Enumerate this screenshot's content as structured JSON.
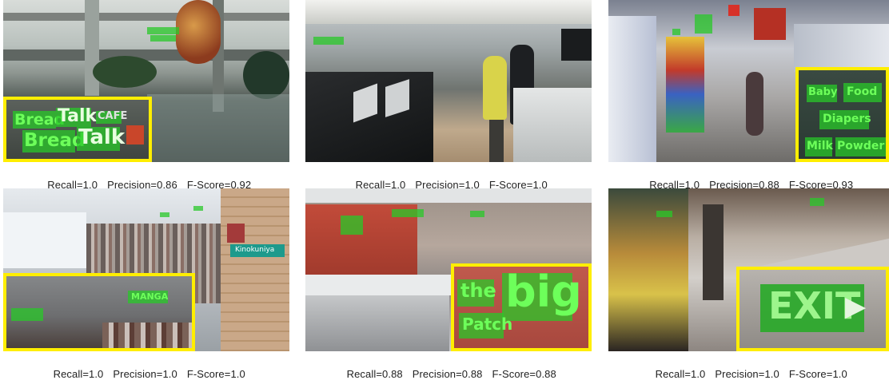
{
  "panels": [
    {
      "caption": {
        "recall": "Recall=1.0",
        "precision": "Precision=0.86",
        "fscore": "F-Score=0.92"
      },
      "inset_text": [
        "Bread",
        "Talk",
        "CAFE",
        "Bread",
        "Talk"
      ]
    },
    {
      "caption": {
        "recall": "Recall=1.0",
        "precision": "Precision=1.0",
        "fscore": "F-Score=1.0"
      },
      "inset_text": []
    },
    {
      "caption": {
        "recall": "Recall=1.0",
        "precision": "Precision=0.88",
        "fscore": "F-Score=0.93"
      },
      "inset_text": [
        "Baby",
        "Food",
        "Diapers",
        "Milk",
        "Powder"
      ]
    },
    {
      "caption": {
        "recall": "Recall=1.0",
        "precision": "Precision=1.0",
        "fscore": "F-Score=1.0"
      },
      "inset_text": [
        "MANGA"
      ],
      "scene_text": "Kinokuniya"
    },
    {
      "caption": {
        "recall": "Recall=0.88",
        "precision": "Precision=0.88",
        "fscore": "F-Score=0.88"
      },
      "inset_text": [
        "the",
        "big",
        "Patch"
      ]
    },
    {
      "caption": {
        "recall": "Recall=1.0",
        "precision": "Precision=1.0",
        "fscore": "F-Score=1.0"
      },
      "inset_text": [
        "EXIT"
      ]
    }
  ],
  "colors": {
    "highlight": "#ffee00",
    "detection": "#28c828"
  }
}
